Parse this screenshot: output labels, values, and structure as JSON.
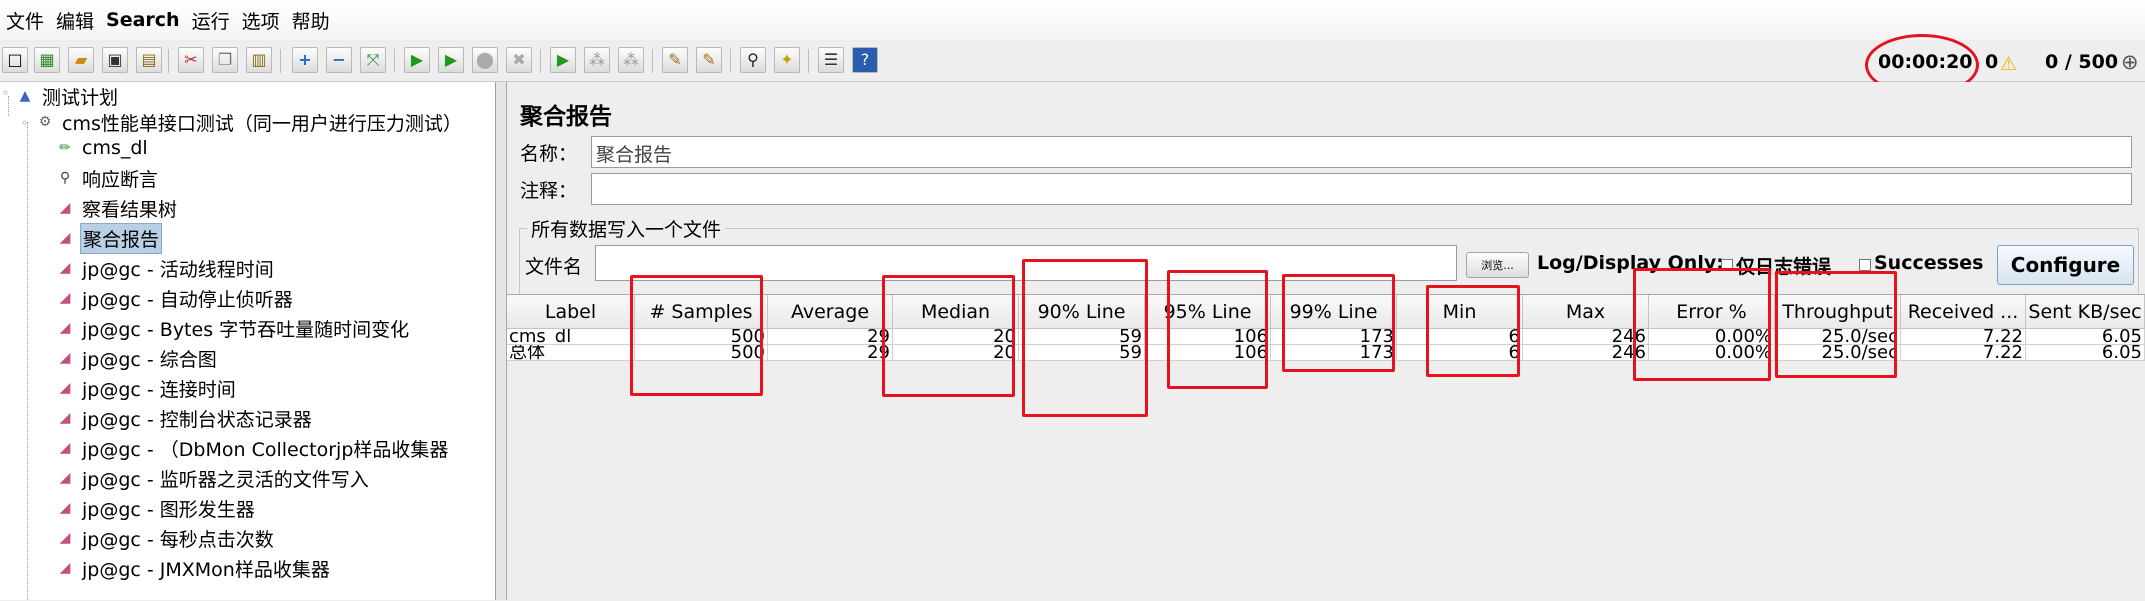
{
  "menu": [
    "文件",
    "编辑",
    "Search",
    "运行",
    "选项",
    "帮助"
  ],
  "status": {
    "elapsed": "00:00:20",
    "warnings": "0",
    "threads": "0 / 500"
  },
  "tree": {
    "root": "测试计划",
    "group": "cms性能单接口测试（同一用户进行压力测试）",
    "items": [
      "cms_dl",
      "响应断言",
      "察看结果树",
      "聚合报告",
      "jp@gc - 活动线程时间",
      "jp@gc - 自动停止侦听器",
      "jp@gc - Bytes 字节吞吐量随时间变化",
      "jp@gc - 综合图",
      "jp@gc - 连接时间",
      "jp@gc - 控制台状态记录器",
      "jp@gc - （DbMon Collectorjp样品收集器",
      "jp@gc - 监听器之灵活的文件写入",
      "jp@gc - 图形发生器",
      "jp@gc - 每秒点击次数",
      "jp@gc - JMXMon样品收集器"
    ],
    "selected_index": 3
  },
  "report": {
    "title": "聚合报告",
    "name_label": "名称：",
    "name_value": "聚合报告",
    "comment_label": "注释：",
    "comment_value": "",
    "file_section": "所有数据写入一个文件",
    "filename_label": "文件名",
    "filename_value": "",
    "browse_label": "浏览...",
    "log_display_label": "Log/Display Only:",
    "errors_only_label": "仅日志错误",
    "successes_label": "Successes",
    "configure_label": "Configure"
  },
  "table": {
    "columns": [
      "Label",
      "# Samples",
      "Average",
      "Median",
      "90% Line",
      "95% Line",
      "99% Line",
      "Min",
      "Max",
      "Error %",
      "Throughput",
      "Received ...",
      "Sent KB/sec"
    ],
    "rows": [
      [
        "cms_dl",
        "500",
        "29",
        "20",
        "59",
        "106",
        "173",
        "6",
        "246",
        "0.00%",
        "25.0/sec",
        "7.22",
        "6.05"
      ],
      [
        "总体",
        "500",
        "29",
        "20",
        "59",
        "106",
        "173",
        "6",
        "246",
        "0.00%",
        "25.0/sec",
        "7.22",
        "6.05"
      ]
    ]
  },
  "colors": {
    "annotation": "#e8121e",
    "selection": "#b8cfe5"
  }
}
